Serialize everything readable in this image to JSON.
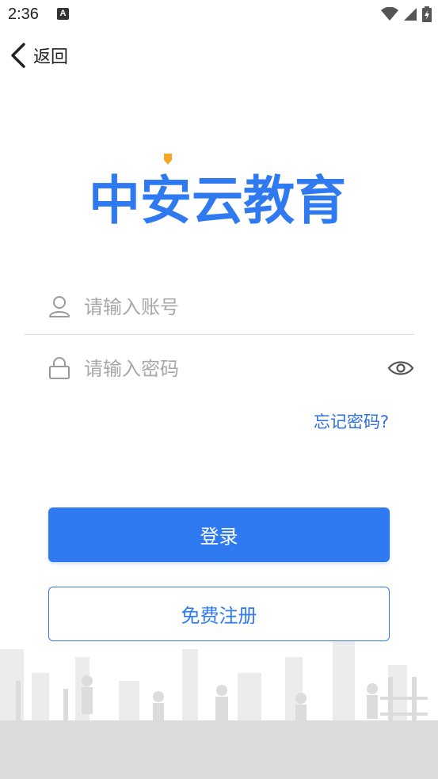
{
  "status_bar": {
    "time": "2:36",
    "notification": "A"
  },
  "nav": {
    "back_label": "返回"
  },
  "brand": {
    "name": "中安云教育",
    "color": "#2f7af0",
    "accent": "#f5a623"
  },
  "login_form": {
    "account_placeholder": "请输入账号",
    "password_placeholder": "请输入密码",
    "forgot_label": "忘记密码?",
    "login_label": "登录",
    "register_label": "免费注册"
  },
  "colors": {
    "primary": "#2f7af0",
    "placeholder": "#a8a8a8",
    "divider": "#e0e0e0"
  },
  "icons": {
    "user": "user-icon",
    "lock": "lock-icon",
    "eye": "eye-icon",
    "back": "chevron-left-icon",
    "wifi": "wifi-icon",
    "signal": "signal-icon",
    "battery": "battery-icon"
  }
}
